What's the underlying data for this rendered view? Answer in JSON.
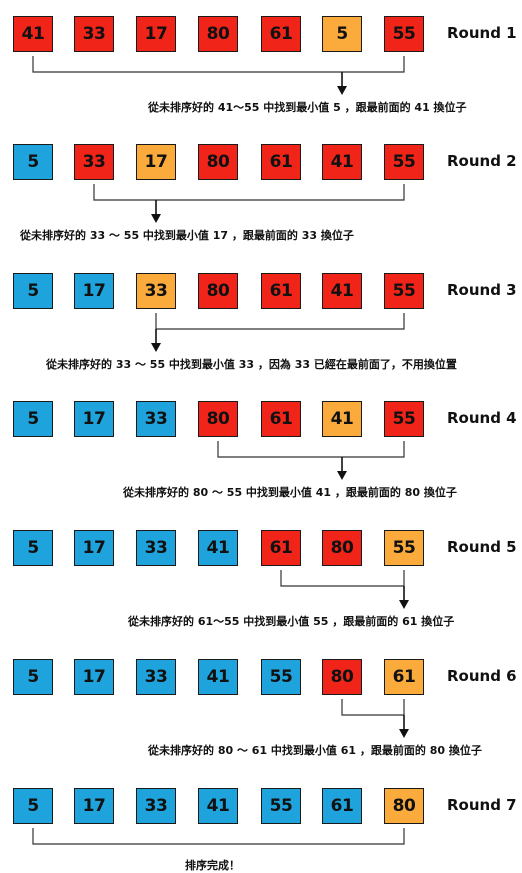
{
  "colors": {
    "unsorted": "#f02418",
    "minimum": "#fbab3c",
    "sorted": "#1fa3dc",
    "stroke": "#1a1a1a"
  },
  "rounds": [
    {
      "label": "Round 1",
      "boxes": [
        {
          "value": "41",
          "state": "unsorted"
        },
        {
          "value": "33",
          "state": "unsorted"
        },
        {
          "value": "17",
          "state": "unsorted"
        },
        {
          "value": "80",
          "state": "unsorted"
        },
        {
          "value": "61",
          "state": "unsorted"
        },
        {
          "value": "5",
          "state": "minimum"
        },
        {
          "value": "55",
          "state": "unsorted"
        }
      ],
      "bracket": {
        "from": 0,
        "to": 6,
        "arrow": 5
      },
      "caption": "從未排序好的 41～55 中找到最小值 5 ，跟最前面的 41 換位子"
    },
    {
      "label": "Round 2",
      "boxes": [
        {
          "value": "5",
          "state": "sorted"
        },
        {
          "value": "33",
          "state": "unsorted"
        },
        {
          "value": "17",
          "state": "minimum"
        },
        {
          "value": "80",
          "state": "unsorted"
        },
        {
          "value": "61",
          "state": "unsorted"
        },
        {
          "value": "41",
          "state": "unsorted"
        },
        {
          "value": "55",
          "state": "unsorted"
        }
      ],
      "bracket": {
        "from": 1,
        "to": 6,
        "arrow": 2
      },
      "caption": "從未排序好的 33 ～ 55 中找到最小值 17 ，跟最前面的 33 換位子"
    },
    {
      "label": "Round 3",
      "boxes": [
        {
          "value": "5",
          "state": "sorted"
        },
        {
          "value": "17",
          "state": "sorted"
        },
        {
          "value": "33",
          "state": "minimum"
        },
        {
          "value": "80",
          "state": "unsorted"
        },
        {
          "value": "61",
          "state": "unsorted"
        },
        {
          "value": "41",
          "state": "unsorted"
        },
        {
          "value": "55",
          "state": "unsorted"
        }
      ],
      "bracket": {
        "from": 2,
        "to": 6,
        "arrow": 2
      },
      "caption": "從未排序好的 33 ～ 55 中找到最小值 33 ，因為 33 已經在最前面了，不用換位置"
    },
    {
      "label": "Round 4",
      "boxes": [
        {
          "value": "5",
          "state": "sorted"
        },
        {
          "value": "17",
          "state": "sorted"
        },
        {
          "value": "33",
          "state": "sorted"
        },
        {
          "value": "80",
          "state": "unsorted"
        },
        {
          "value": "61",
          "state": "unsorted"
        },
        {
          "value": "41",
          "state": "minimum"
        },
        {
          "value": "55",
          "state": "unsorted"
        }
      ],
      "bracket": {
        "from": 3,
        "to": 6,
        "arrow": 5
      },
      "caption": "從未排序好的 80 ～ 55 中找到最小值 41 ，跟最前面的 80 換位子"
    },
    {
      "label": "Round 5",
      "boxes": [
        {
          "value": "5",
          "state": "sorted"
        },
        {
          "value": "17",
          "state": "sorted"
        },
        {
          "value": "33",
          "state": "sorted"
        },
        {
          "value": "41",
          "state": "sorted"
        },
        {
          "value": "61",
          "state": "unsorted"
        },
        {
          "value": "80",
          "state": "unsorted"
        },
        {
          "value": "55",
          "state": "minimum"
        }
      ],
      "bracket": {
        "from": 4,
        "to": 6,
        "arrow": 6
      },
      "caption": "從未排序好的 61～55 中找到最小值 55 ，跟最前面的 61 換位子"
    },
    {
      "label": "Round 6",
      "boxes": [
        {
          "value": "5",
          "state": "sorted"
        },
        {
          "value": "17",
          "state": "sorted"
        },
        {
          "value": "33",
          "state": "sorted"
        },
        {
          "value": "41",
          "state": "sorted"
        },
        {
          "value": "55",
          "state": "sorted"
        },
        {
          "value": "80",
          "state": "unsorted"
        },
        {
          "value": "61",
          "state": "minimum"
        }
      ],
      "bracket": {
        "from": 5,
        "to": 6,
        "arrow": 6
      },
      "caption": "從未排序好的 80 ～ 61 中找到最小值 61 ，跟最前面的 80 換位子"
    },
    {
      "label": "Round 7",
      "boxes": [
        {
          "value": "5",
          "state": "sorted"
        },
        {
          "value": "17",
          "state": "sorted"
        },
        {
          "value": "33",
          "state": "sorted"
        },
        {
          "value": "41",
          "state": "sorted"
        },
        {
          "value": "55",
          "state": "sorted"
        },
        {
          "value": "61",
          "state": "sorted"
        },
        {
          "value": "80",
          "state": "minimum"
        }
      ],
      "bracket": {
        "from": 0,
        "to": 6,
        "arrow": null
      },
      "caption": "排序完成！"
    }
  ]
}
